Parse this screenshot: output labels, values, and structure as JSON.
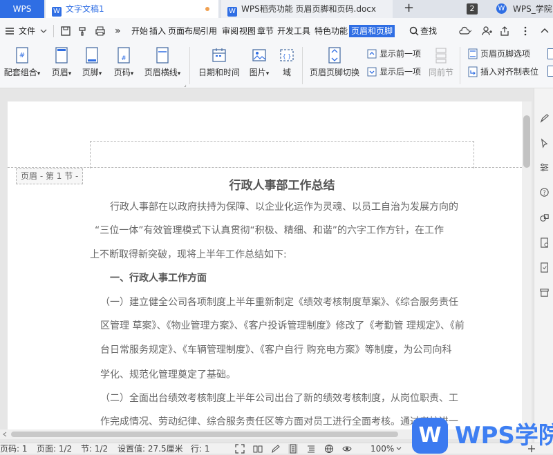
{
  "tabbar": {
    "app_name": "WPS",
    "tabs": [
      {
        "label": "文字文稿1",
        "icon": "W"
      },
      {
        "label": "WPS稻壳功能 页眉页脚和页码.docx",
        "icon": "W"
      }
    ],
    "new_tab_glyph": "+",
    "window_count": "2",
    "user_name": "WPS_学院"
  },
  "menubar": {
    "file_label": "文件",
    "more_glyph": "»",
    "items": [
      "开始",
      "插入",
      "页面布局",
      "引用",
      "审阅",
      "视图",
      "章节",
      "开发工具",
      "特色功能",
      "页眉和页脚"
    ],
    "active_item": "页眉和页脚",
    "search_label": "查找"
  },
  "ribbon": {
    "big_buttons": [
      "配套组合",
      "页眉",
      "页脚",
      "页码",
      "页眉横线",
      "日期和时间",
      "图片",
      "域",
      "页眉页脚切换",
      "同前节"
    ],
    "small_buttons": [
      "显示前一项",
      "显示后一项",
      "页眉页脚选项",
      "插入对齐制表位"
    ],
    "dropdown_glyph": "▾"
  },
  "document": {
    "header_label": "页眉 - 第 1 节 -",
    "title": "行政人事部工作总结",
    "lines": [
      "行政人事部在以政府扶持为保障、以企业化运作为灵魂、以员工自治为发展方向的",
      "“三位一体”有效管理模式下认真贯彻“积极、精细、和谐”的六字工作方针，在工作",
      "上不断取得新突破，现将上半年工作总结如下:",
      "一、行政人事工作方面",
      "（一）建立健全公司各项制度上半年重新制定《绩效考核制度草案》、《综合服务责任",
      "区管理 草案》、《物业管理方案》、《客户投诉管理制度》修改了《考勤管 理规定》、《前",
      "台日常服务规定》、《车辆管理制度》、《客户自行 购充电方案》等制度，为公司向科",
      "学化、规范化管理奠定了基础。",
      "（二）全面出台绩效考核制度上半年公司出台了新的绩效考核制度，从岗位职责、工",
      "作完成情况、劳动纪律、综合服务责任区等方面对员工进行全面考核。通过考核进一"
    ]
  },
  "statusbar": {
    "page_num": "页码: 1",
    "page": "页面: 1/2",
    "section": "节: 1/2",
    "setting": "设置值: 27.5厘米",
    "row": "行: 1",
    "zoom": "100%"
  },
  "watermark": {
    "logo_letter": "W",
    "text": "WPS学院"
  },
  "colors": {
    "accent": "#2f6ee4",
    "watermark": "#3d7ef2"
  }
}
